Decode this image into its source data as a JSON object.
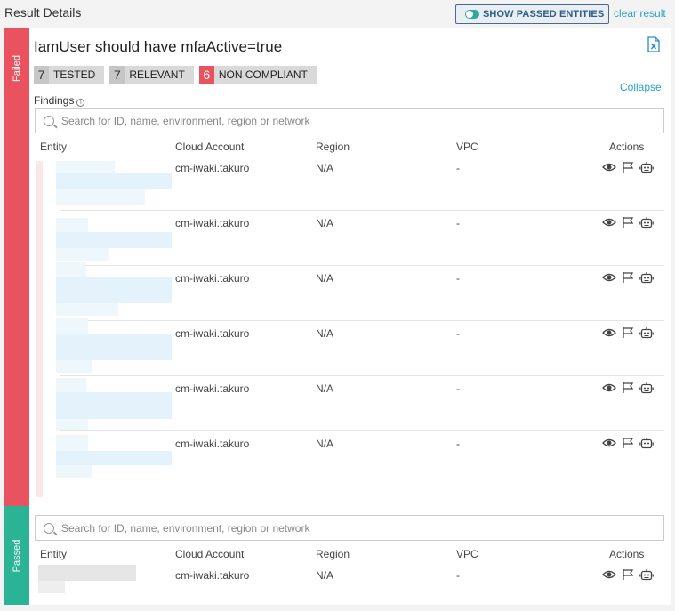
{
  "header": {
    "title": "Result Details",
    "toggle_label": "SHOW PASSED ENTITIES",
    "clear_label": "clear result"
  },
  "sides": {
    "failed": "Failed",
    "passed": "Passed"
  },
  "rule": {
    "title": "IamUser should have mfaActive=true"
  },
  "stats": [
    {
      "num": "7",
      "label": "TESTED"
    },
    {
      "num": "7",
      "label": "RELEVANT"
    },
    {
      "num": "6",
      "label": "NON COMPLIANT"
    }
  ],
  "collapse_label": "Collapse",
  "findings_label": "Findings",
  "search": {
    "placeholder": "Search for ID, name, environment, region or network"
  },
  "columns": {
    "entity": "Entity",
    "account": "Cloud Account",
    "region": "Region",
    "vpc": "VPC",
    "actions": "Actions"
  },
  "failed_rows": [
    {
      "account": "cm-iwaki.takuro",
      "region": "N/A",
      "vpc": "-"
    },
    {
      "account": "cm-iwaki.takuro",
      "region": "N/A",
      "vpc": "-"
    },
    {
      "account": "cm-iwaki.takuro",
      "region": "N/A",
      "vpc": "-"
    },
    {
      "account": "cm-iwaki.takuro",
      "region": "N/A",
      "vpc": "-"
    },
    {
      "account": "cm-iwaki.takuro",
      "region": "N/A",
      "vpc": "-"
    },
    {
      "account": "cm-iwaki.takuro",
      "region": "N/A",
      "vpc": "-"
    }
  ],
  "passed_rows": [
    {
      "account": "cm-iwaki.takuro",
      "region": "N/A",
      "vpc": "-"
    }
  ],
  "icons": [
    "eye-icon",
    "flag-icon",
    "bot-icon",
    "excel-export-icon",
    "search-icon",
    "info-icon"
  ],
  "colors": {
    "failed": "#e9535f",
    "passed": "#2ab495",
    "link": "#2ba3c9"
  }
}
